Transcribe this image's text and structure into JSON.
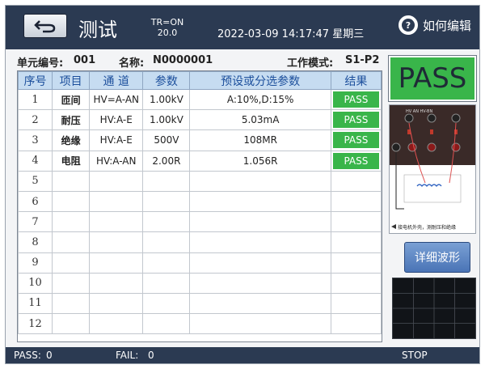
{
  "header": {
    "title": "测试",
    "tr_line1": "TR=ON",
    "tr_line2": "20.0",
    "datetime": "2022-03-09 14:17:47 星期三",
    "help_label": "如何编辑",
    "help_icon": "question-icon",
    "back_icon": "back-arrow-icon"
  },
  "info": {
    "unit_label": "单元编号:",
    "unit_value": "001",
    "name_label": "名称:",
    "name_value": "N0000001",
    "mode_label": "工作模式:",
    "mode_value": "S1-P2"
  },
  "table": {
    "columns": [
      "序号",
      "项目",
      "通 道",
      "参数",
      "预设或分选参数",
      "结果"
    ],
    "rows": [
      {
        "idx": "1",
        "item": "匝间",
        "channel": "HV=A-AN",
        "param": "1.00kV",
        "preset": "A:10%,D:15%",
        "result": "PASS"
      },
      {
        "idx": "2",
        "item": "耐压",
        "channel": "HV:A-E",
        "param": "1.00kV",
        "preset": "5.03mA",
        "result": "PASS"
      },
      {
        "idx": "3",
        "item": "绝缘",
        "channel": "HV:A-E",
        "param": "500V",
        "preset": "108MR",
        "result": "PASS"
      },
      {
        "idx": "4",
        "item": "电阻",
        "channel": "HV:A-AN",
        "param": "2.00R",
        "preset": "1.056R",
        "result": "PASS"
      },
      {
        "idx": "5",
        "item": "",
        "channel": "",
        "param": "",
        "preset": "",
        "result": ""
      },
      {
        "idx": "6",
        "item": "",
        "channel": "",
        "param": "",
        "preset": "",
        "result": ""
      },
      {
        "idx": "7",
        "item": "",
        "channel": "",
        "param": "",
        "preset": "",
        "result": ""
      },
      {
        "idx": "8",
        "item": "",
        "channel": "",
        "param": "",
        "preset": "",
        "result": ""
      },
      {
        "idx": "9",
        "item": "",
        "channel": "",
        "param": "",
        "preset": "",
        "result": ""
      },
      {
        "idx": "10",
        "item": "",
        "channel": "",
        "param": "",
        "preset": "",
        "result": ""
      },
      {
        "idx": "11",
        "item": "",
        "channel": "",
        "param": "",
        "preset": "",
        "result": ""
      },
      {
        "idx": "12",
        "item": "",
        "channel": "",
        "param": "",
        "preset": "",
        "result": ""
      }
    ]
  },
  "result_panel": {
    "overall": "PASS",
    "diagram_caption": "接电机外壳，测耐压和绝缘",
    "detail_button": "详细波形"
  },
  "status": {
    "pass_label": "PASS:",
    "pass_count": "0",
    "fail_label": "FAIL:",
    "fail_count": "0",
    "state": "STOP"
  },
  "colors": {
    "header_bg": "#2b3a52",
    "pass_green": "#39b54a",
    "table_header_bg": "#c6dcf1",
    "table_header_text": "#1c4f9c",
    "button_blue": "#4a74b6"
  }
}
